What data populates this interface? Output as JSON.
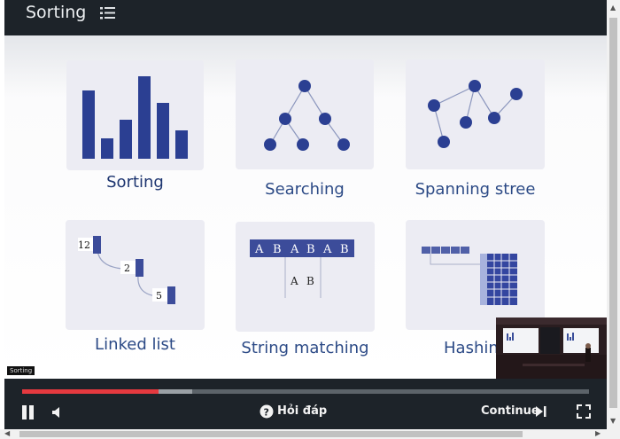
{
  "header": {
    "title": "Sorting"
  },
  "cards": [
    {
      "label": "Sorting"
    },
    {
      "label": "Searching"
    },
    {
      "label": "Spanning stree"
    },
    {
      "label": "Linked list",
      "values": [
        "12",
        "2",
        "5"
      ]
    },
    {
      "label": "String matching",
      "text": [
        "A",
        "B",
        "A",
        "B",
        "A",
        "B"
      ],
      "pattern": [
        "A",
        "B"
      ]
    },
    {
      "label": "Hashin"
    }
  ],
  "overlay_tag": "Sorting",
  "controls": {
    "faq_label": "Hỏi đáp",
    "continue_label": "Continue",
    "progress_played": 0.24,
    "progress_buffered": 0.3
  },
  "colors": {
    "accent": "#2c3e8f",
    "progress": "#e5393f",
    "bar": "#1d2329"
  }
}
